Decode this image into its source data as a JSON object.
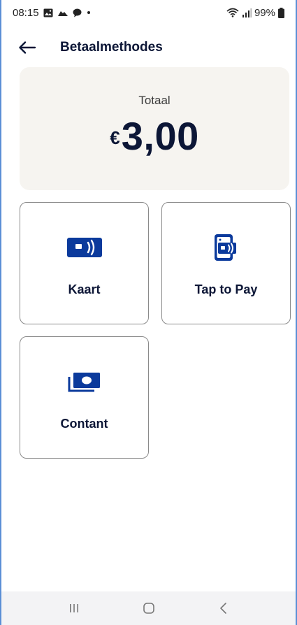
{
  "status_bar": {
    "time": "08:15",
    "battery": "99%",
    "icons": [
      "image-icon",
      "cloud-icon",
      "chat-icon",
      "dot-icon"
    ],
    "right_icons": [
      "wifi-icon",
      "signal-icon",
      "battery-icon"
    ]
  },
  "header": {
    "title": "Betaalmethodes",
    "back_icon": "arrow-left-icon"
  },
  "total": {
    "label": "Totaal",
    "currency": "€",
    "amount": "3,00"
  },
  "methods": [
    {
      "label": "Kaart",
      "icon": "card-contactless-icon"
    },
    {
      "label": "Tap to Pay",
      "icon": "phone-tap-icon"
    },
    {
      "label": "Contant",
      "icon": "cash-icon"
    }
  ],
  "nav_bar": {
    "icons": [
      "recent-apps-icon",
      "home-icon",
      "back-icon"
    ]
  },
  "colors": {
    "primary": "#0c1636",
    "icon_blue": "#0b3a9c",
    "card_bg": "#f6f4f0",
    "border": "#8a8a8a"
  }
}
